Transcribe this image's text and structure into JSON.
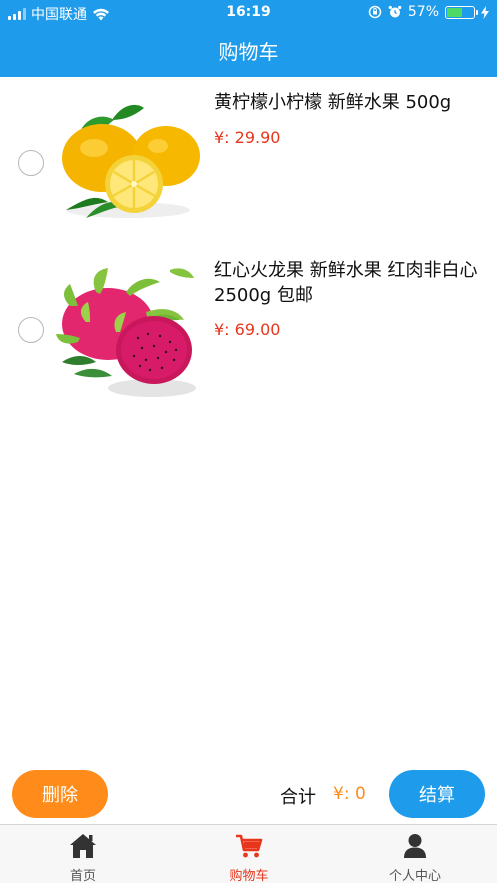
{
  "status_bar": {
    "carrier": "中国联通",
    "time": "16:19",
    "battery_percent": "57%",
    "battery_level": 0.57,
    "icons": [
      "signal-icon",
      "wifi-icon",
      "rotation-lock-icon",
      "alarm-icon",
      "battery-icon",
      "charging-icon"
    ]
  },
  "header": {
    "title": "购物车"
  },
  "cart": {
    "items": [
      {
        "name": "黄柠檬小柠檬 新鲜水果 500g",
        "price": "¥: 29.90",
        "selected": false,
        "image": "lemon-image"
      },
      {
        "name": "红心火龙果 新鲜水果 红肉非白心 2500g 包邮",
        "price": "¥: 69.00",
        "selected": false,
        "image": "dragon-fruit-image"
      }
    ]
  },
  "actions": {
    "delete_label": "删除",
    "total_label": "合计",
    "total_value": "¥: 0",
    "checkout_label": "结算"
  },
  "tabbar": {
    "tabs": [
      {
        "label": "首页",
        "icon": "home-icon",
        "active": false
      },
      {
        "label": "购物车",
        "icon": "cart-icon",
        "active": true
      },
      {
        "label": "个人中心",
        "icon": "user-icon",
        "active": false
      }
    ]
  },
  "colors": {
    "primary": "#1e9bea",
    "accent_orange": "#ff8c1a",
    "price_red": "#e8361c"
  }
}
